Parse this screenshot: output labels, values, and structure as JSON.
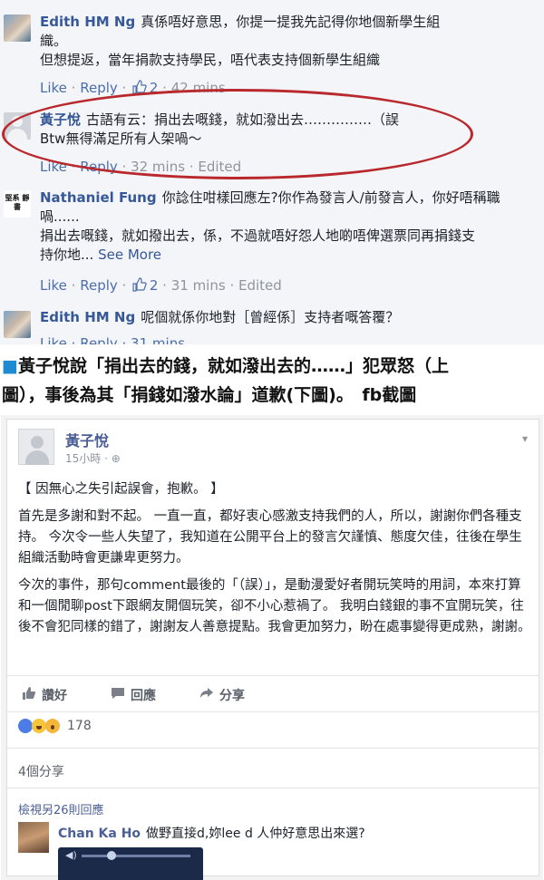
{
  "comments": [
    {
      "author": "Edith HM Ng",
      "lines": [
        "真係唔好意思，你提一提我先記得你地個新學生組",
        "織。",
        "但想提返，當年捐款支持學民，唔代表支持個新學生組織"
      ],
      "like": "Like",
      "reply": "Reply",
      "likes_count": "2",
      "time": "42 mins"
    },
    {
      "author": "黃子悅",
      "lines": [
        "古語有云：捐出去嘅錢，就如潑出去……………（誤",
        "Btw無得滿足所有人架喎～"
      ],
      "like": "Like",
      "reply": "Reply",
      "time": "32 mins",
      "edited": "Edited"
    },
    {
      "author": "Nathaniel Fung",
      "avatar_text": "堅系 靜書",
      "lines": [
        "你諗住咁樣回應左?你作為發言人/前發言人，你好唔稱職",
        "喎......",
        "捐出去嘅錢，就如撥出去，係，不過就唔好怨人地啲唔俾選票同再捐錢支",
        "持你地..."
      ],
      "see_more": "See More",
      "like": "Like",
      "reply": "Reply",
      "likes_count": "2",
      "time": "31 mins",
      "edited": "Edited"
    },
    {
      "author": "Edith HM Ng",
      "lines": [
        "呢個就係你地對［曾經係］支持者嘅答覆？"
      ],
      "partial_actions": "Like · Reply · 31 mins"
    }
  ],
  "caption": {
    "line1": "黃子悅說「捐出去的錢，就如潑出去的……」犯眾怒（上",
    "line2": "圖），事後為其「捐錢如潑水論」道歉(下圖)。　fb截圖"
  },
  "post": {
    "author": "黃子悅",
    "time": "15小時",
    "body": [
      "【 因無心之失引起誤會，抱歉。 】",
      "首先是多謝和對不起。 一直一直，都好衷心感激支持我們的人，所以，謝謝你們各種支持。 今次令一些人失望了，我知道在公開平台上的發言欠謹慎、態度欠佳，往後在學生組織活動時會更謙卑更努力。",
      "今次的事件，那句comment最後的「（誤）」，是動漫愛好者開玩笑時的用詞，本來打算和一個閒聊post下跟網友開個玩笑，卻不小心惹禍了。 我明白錢銀的事不宜開玩笑，往後不會犯同樣的錯了，謝謝友人善意提點。我會更加努力，盼在處事變得更成熟，謝謝。"
    ],
    "actions": {
      "like": "讚好",
      "comment": "回應",
      "share": "分享"
    },
    "reactions_count": "178",
    "shares": "4個分享",
    "view_previous": "檢視另26則回應",
    "comment": {
      "author": "Chan Ka Ho",
      "text": "做野直接d,妳lee d 人仲好意思出來選?"
    }
  },
  "colors": {
    "link": "#365899",
    "highlight_ring": "#b8282c",
    "caption_square": "#1d8ad1"
  }
}
